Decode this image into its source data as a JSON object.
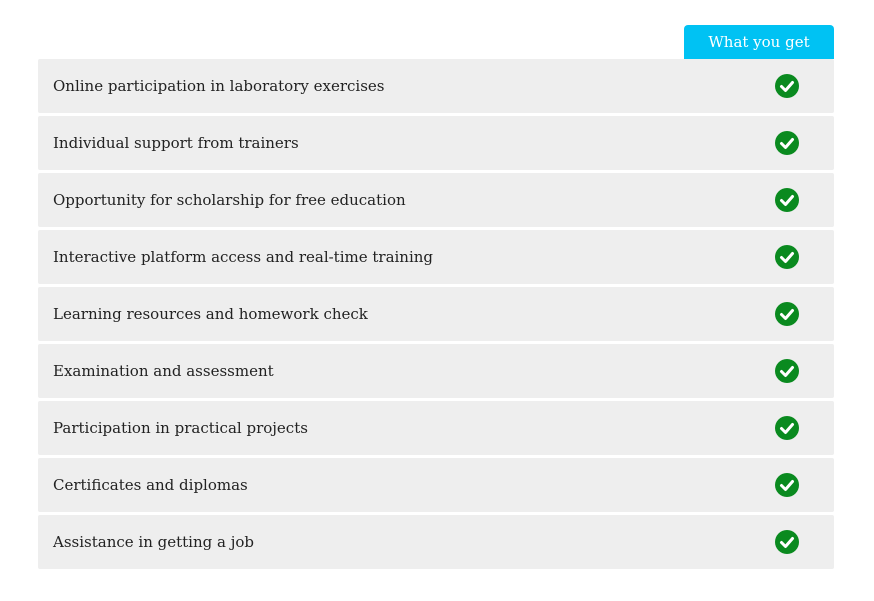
{
  "header": {
    "title": "What you get",
    "accent_color": "#00c2f3"
  },
  "features": [
    {
      "label": "Online participation in laboratory exercises",
      "included": true
    },
    {
      "label": "Individual support from trainers",
      "included": true
    },
    {
      "label": "Opportunity for scholarship for free education",
      "included": true
    },
    {
      "label": "Interactive platform access and real-time training",
      "included": true
    },
    {
      "label": "Learning resources and homework check",
      "included": true
    },
    {
      "label": "Examination and assessment",
      "included": true
    },
    {
      "label": "Participation in practical projects",
      "included": true
    },
    {
      "label": "Certificates and diplomas",
      "included": true
    },
    {
      "label": "Assistance in getting a job",
      "included": true
    }
  ],
  "icons": {
    "included": "check-circle-icon",
    "check_color": "#0a8a1f"
  },
  "colors": {
    "row_background": "#eeeeee",
    "text": "#222222"
  }
}
